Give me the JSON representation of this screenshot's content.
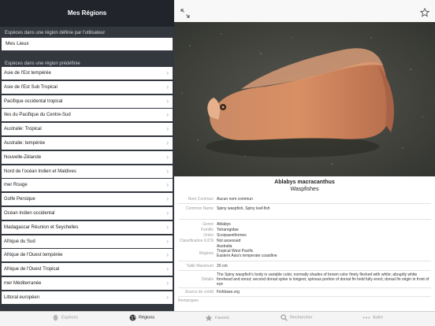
{
  "left": {
    "title": "Mes Régions",
    "user_section": "Espèces dans une région définie par l'utilisateur",
    "my_places": "Mes Lieux",
    "predefined_section": "Espèces dans une région prédéfinie",
    "regions": [
      "Asie de l'Est tempérée",
      "Asie de l'Est Sub Tropical",
      "Pacifique occidental tropical",
      "Iles du Pacifique du Centre-Sud",
      "Australie: Tropical",
      "Australie: tempérée",
      "Nouvelle-Zélande",
      "Nord de l'océan Indien et Maldives",
      "mer Rouge",
      "Golfe Persique",
      "Océan Indien occidental",
      "Madagascar Réunion et Seychelles",
      "Afrique du Sud",
      "Afrique de l'Ouest tempérée",
      "Afrique de l'Ouest Tropical",
      "mer Méditerranée",
      "Littoral européen"
    ]
  },
  "species": {
    "name": "Ablabys macracanthus",
    "family": "Waspfishes",
    "fields": {
      "nom_commun": {
        "label": "Nom Commun",
        "value": "Aucun nom commun"
      },
      "common_name": {
        "label": "Common Name",
        "value": "Spiny waspfish, Spiny leaf-fish"
      },
      "genre": {
        "label": "Genre",
        "value": "Ablabys"
      },
      "famille": {
        "label": "Famille",
        "value": "Tetrarogidae"
      },
      "ordre": {
        "label": "Ordre",
        "value": "Scorpaeniformes"
      },
      "iucn": {
        "label": "Classification IUCN",
        "value": "Not assessed"
      },
      "regions": {
        "label": "Régions",
        "lines": [
          "Australia",
          "Tropical West Pacific",
          "Eastern Asia's temperate coastline"
        ]
      },
      "taille": {
        "label": "Taille Maximum",
        "value": "20 cm"
      },
      "details": {
        "label": "Détails",
        "value": "The Spiny waspfish's body is variable color, normally shades of brown color finely flecked with white; abruptly white forehead and snout; second dorsal spine is longest; spinous portion of dorsal fin held fully erect; dorsal fin origin in front of eye"
      },
      "source": {
        "label": "Source de crédit",
        "value": "Fishbase.org"
      },
      "remarques": {
        "label": "Remarques",
        "value": ""
      }
    }
  },
  "tabs": [
    {
      "label": "Espèces",
      "icon": "fish-icon",
      "active": false
    },
    {
      "label": "Régions",
      "icon": "globe-icon",
      "active": true
    },
    {
      "label": "Favoris",
      "icon": "star-icon",
      "active": false
    },
    {
      "label": "Rechercher",
      "icon": "search-icon",
      "active": false
    },
    {
      "label": "Autre",
      "icon": "more-icon",
      "active": false
    }
  ],
  "colors": {
    "left_panel_bg": "#33383f",
    "nav_dark": "#21252b",
    "accent_inactive": "#9a9a9a",
    "tab_active": "#222222"
  }
}
